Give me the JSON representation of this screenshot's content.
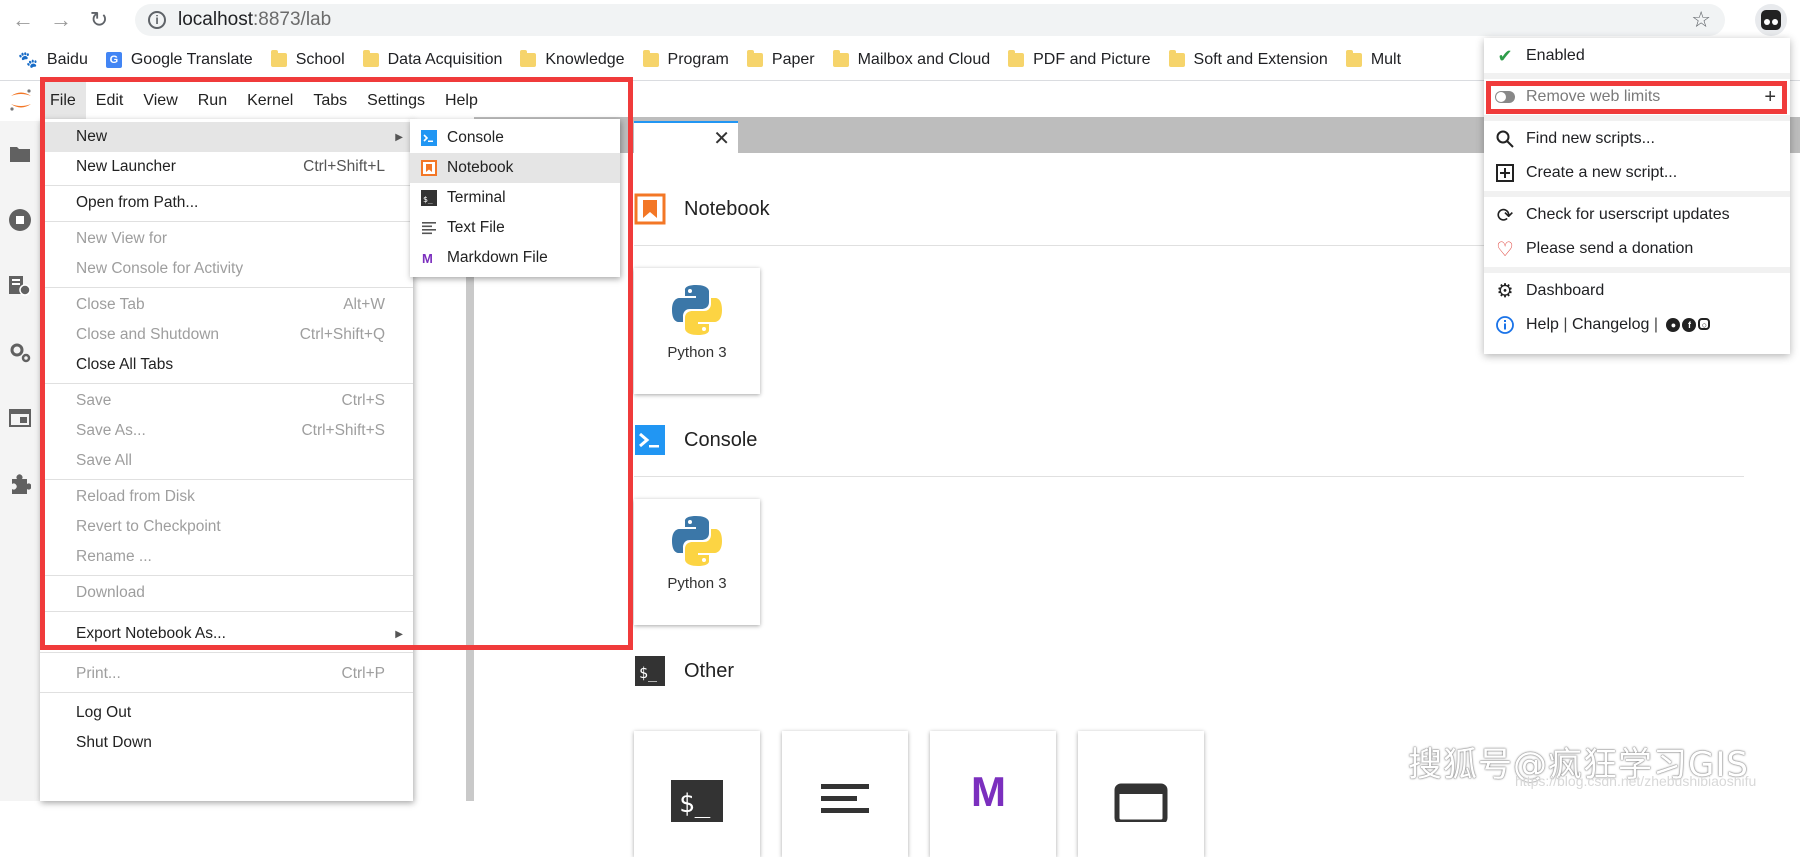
{
  "browser": {
    "url_host": "localhost",
    "url_path": ":8873/lab",
    "bookmarks": [
      {
        "label": "Baidu",
        "icon": "paw-icon"
      },
      {
        "label": "Google Translate",
        "icon": "google-translate-icon"
      },
      {
        "label": "School",
        "icon": "folder-icon"
      },
      {
        "label": "Data Acquisition",
        "icon": "folder-icon"
      },
      {
        "label": "Knowledge",
        "icon": "folder-icon"
      },
      {
        "label": "Program",
        "icon": "folder-icon"
      },
      {
        "label": "Paper",
        "icon": "folder-icon"
      },
      {
        "label": "Mailbox and Cloud",
        "icon": "folder-icon"
      },
      {
        "label": "PDF and Picture",
        "icon": "folder-icon"
      },
      {
        "label": "Soft and Extension",
        "icon": "folder-icon"
      },
      {
        "label": "Mult",
        "icon": "folder-icon"
      }
    ]
  },
  "menubar": [
    "File",
    "Edit",
    "View",
    "Run",
    "Kernel",
    "Tabs",
    "Settings",
    "Help"
  ],
  "file_menu": {
    "new": "New",
    "new_launcher": "New Launcher",
    "new_launcher_sc": "Ctrl+Shift+L",
    "open_from_path": "Open from Path...",
    "new_view_for": "New View for",
    "new_console_for_activity": "New Console for Activity",
    "close_tab": "Close Tab",
    "close_tab_sc": "Alt+W",
    "close_and_shutdown": "Close and Shutdown",
    "close_and_shutdown_sc": "Ctrl+Shift+Q",
    "close_all_tabs": "Close All Tabs",
    "save": "Save",
    "save_sc": "Ctrl+S",
    "save_as": "Save As...",
    "save_as_sc": "Ctrl+Shift+S",
    "save_all": "Save All",
    "reload_from_disk": "Reload from Disk",
    "revert_to_checkpoint": "Revert to Checkpoint",
    "rename": "Rename ...",
    "download": "Download",
    "export_notebook_as": "Export Notebook As...",
    "print": "Print...",
    "print_sc": "Ctrl+P",
    "log_out": "Log Out",
    "shut_down": "Shut Down"
  },
  "new_submenu": [
    "Console",
    "Notebook",
    "Terminal",
    "Text File",
    "Markdown File"
  ],
  "launcher": {
    "notebook_title": "Notebook",
    "console_title": "Console",
    "other_title": "Other",
    "kernel_label": "Python 3"
  },
  "tampermonkey": {
    "enabled": "Enabled",
    "remove_web_limits": "Remove web limits",
    "find_new_scripts": "Find new scripts...",
    "create_new_script": "Create a new script...",
    "check_updates": "Check for userscript updates",
    "donation": "Please send a donation",
    "dashboard": "Dashboard",
    "help": "Help",
    "changelog": "Changelog",
    "pipe": "|"
  },
  "watermark": {
    "text": "搜狐号@疯狂学习GIS",
    "url": "https://blog.csdn.net/zhebushibiaoshifu"
  },
  "colors": {
    "highlight_box": "#f03b3b",
    "jupyter_orange": "#f37726",
    "console_blue": "#2196f3",
    "markdown_purple": "#7b2fbe"
  }
}
